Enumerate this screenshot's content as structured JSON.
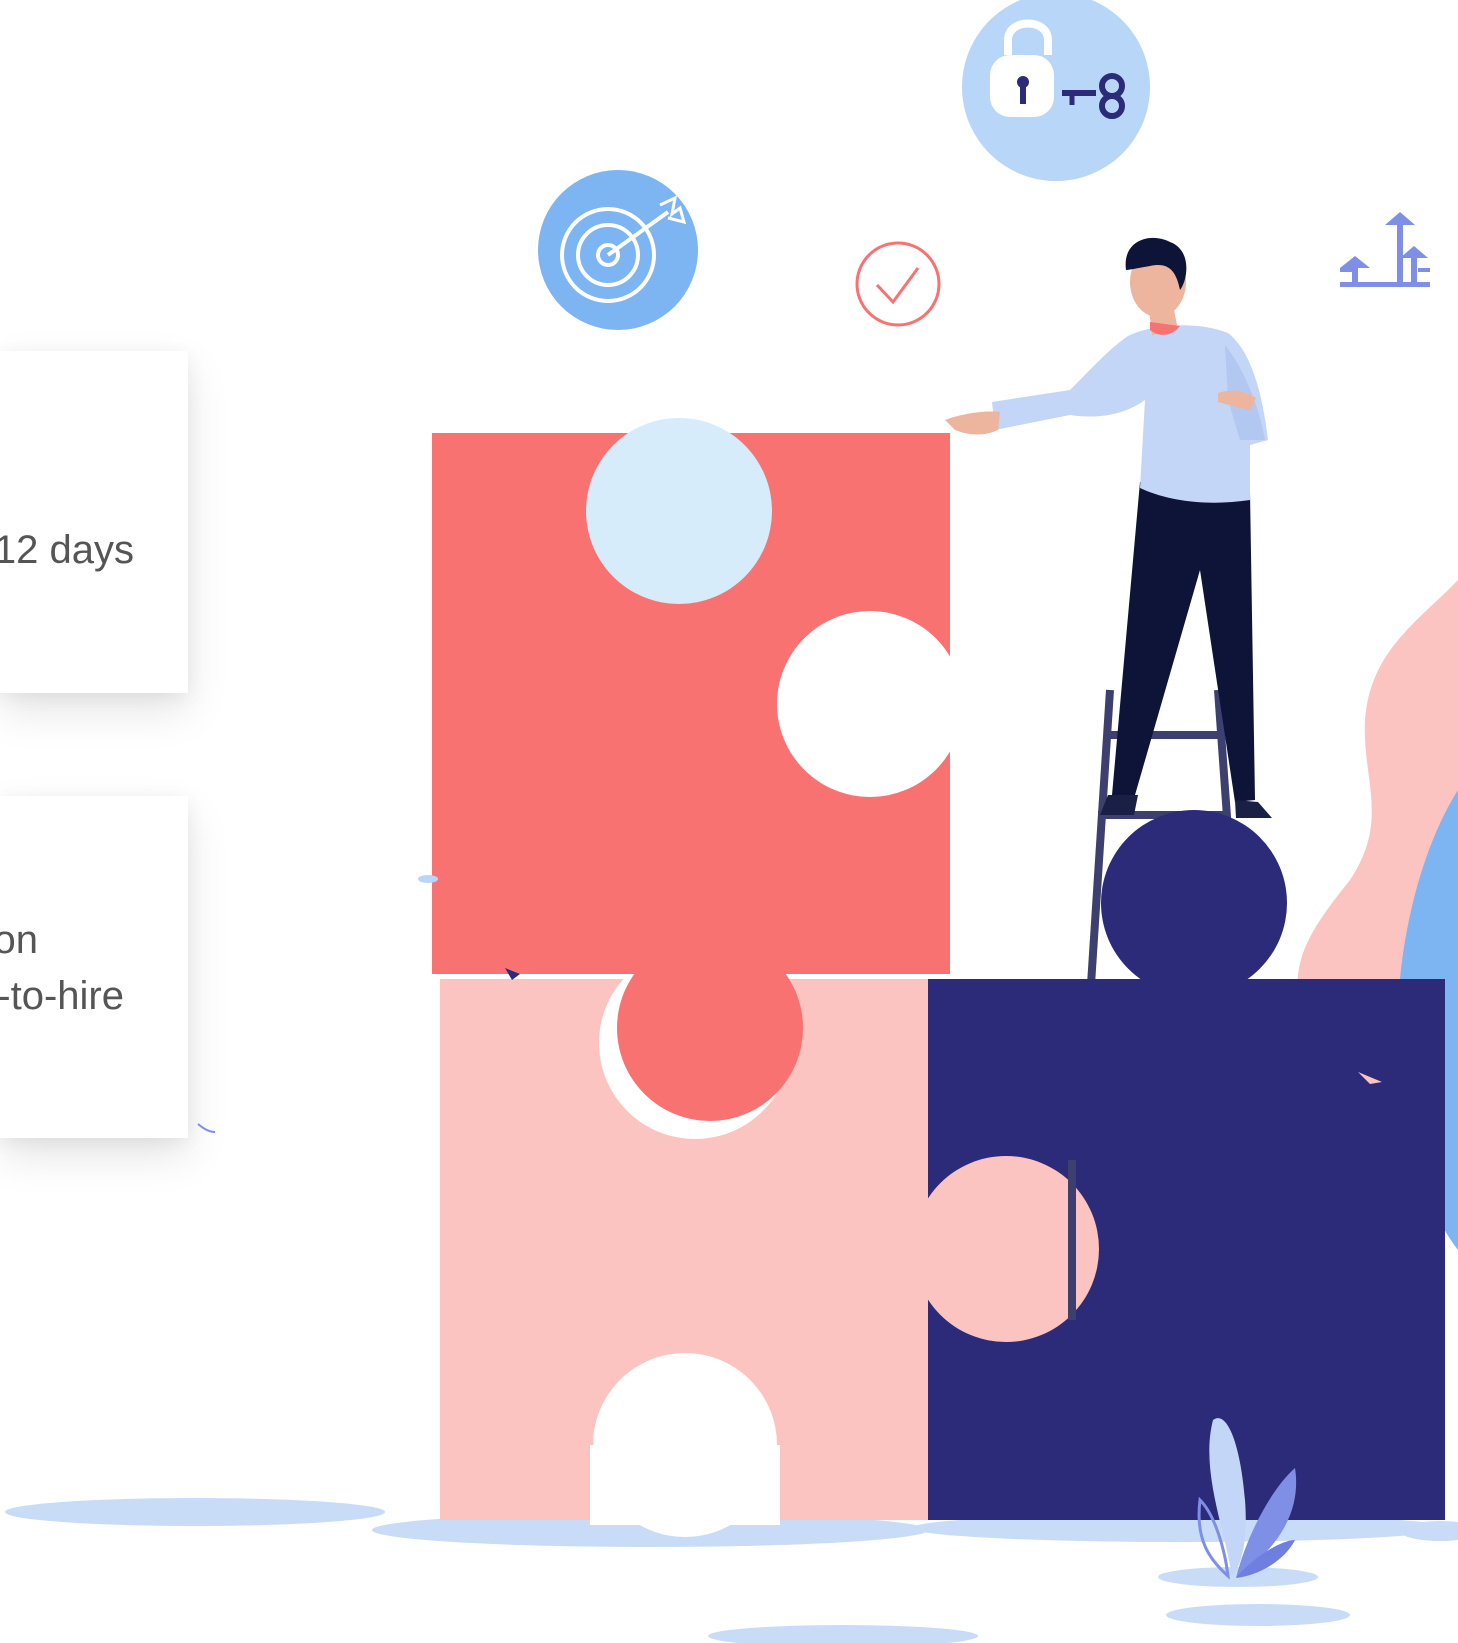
{
  "cards": [
    {
      "lines": [
        "12 days"
      ]
    },
    {
      "lines": [
        "on",
        "-to-hire"
      ]
    }
  ],
  "illustration": {
    "icons": [
      "target-icon",
      "check-icon",
      "lock-key-icon",
      "growth-arrows-icon",
      "plant-icon"
    ],
    "colors": {
      "coral": "#f87272",
      "pink": "#fcc4c0",
      "navy": "#2b2b7a",
      "light_blue": "#b8d6f7",
      "pale_blue": "#d6ecfb",
      "mid_blue": "#7db4f2",
      "shadow_blue": "#c8dcf8",
      "shirt": "#c3d6f7",
      "pants": "#0d1438",
      "skin": "#edb59d",
      "accent_purple": "#7f8fe6"
    }
  }
}
